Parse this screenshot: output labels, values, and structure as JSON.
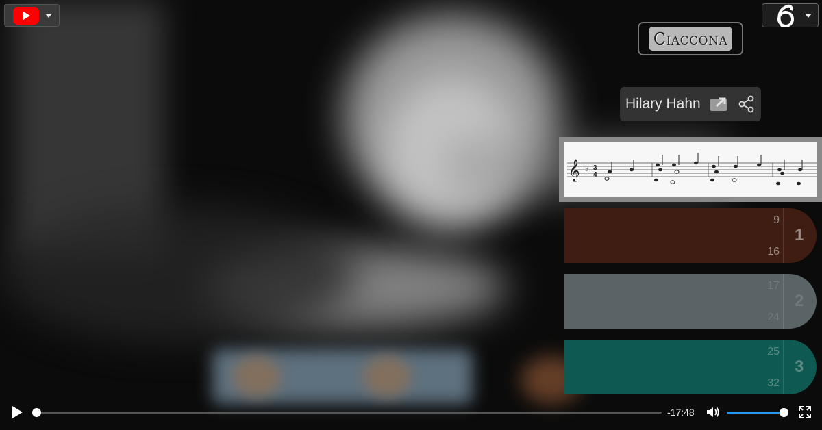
{
  "header": {
    "youtube_icon": "youtube-logo-icon",
    "app_icon": "treble-clef-icon",
    "title": "Ciaccona"
  },
  "performer": {
    "name": "Hilary Hahn",
    "external_icon": "external-link-icon",
    "share_icon": "share-icon"
  },
  "score": {
    "key": "D minor",
    "time_signature": "3/4",
    "icon": "sheet-music-preview"
  },
  "sections": [
    {
      "number": "1",
      "start": "9",
      "end": "16",
      "color": "#3f1d12",
      "text_color": "#9a8a84"
    },
    {
      "number": "2",
      "start": "17",
      "end": "24",
      "color": "#5a6366",
      "text_color": "#717a7d"
    },
    {
      "number": "3",
      "start": "25",
      "end": "32",
      "color": "#0e5a52",
      "text_color": "#5f8984"
    }
  ],
  "player": {
    "time_remaining": "-17:48",
    "progress": 0.0,
    "volume": 1.0,
    "accent": "#2196f3"
  }
}
